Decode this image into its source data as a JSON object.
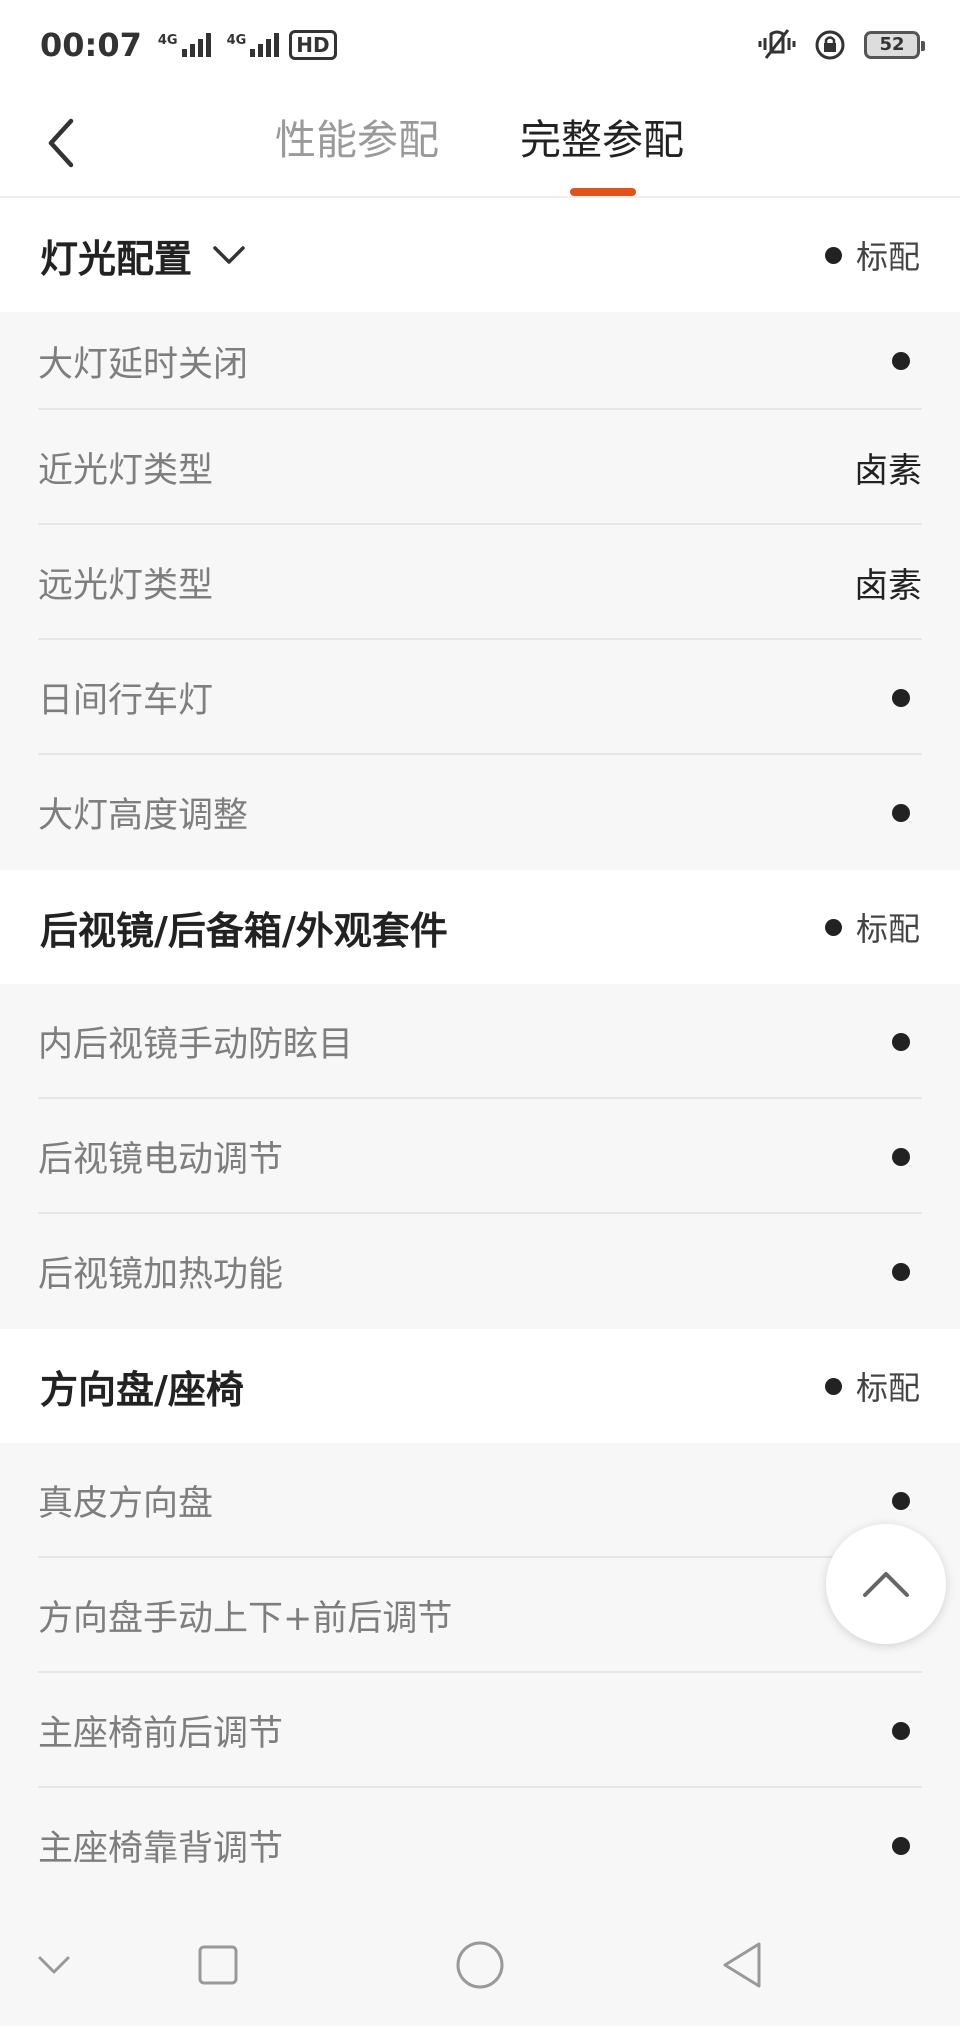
{
  "status_bar": {
    "time": "00:07",
    "network_1": "4G",
    "network_2": "4G",
    "hd": "HD",
    "battery": "52"
  },
  "header": {
    "tabs": [
      {
        "label": "性能参配",
        "active": false
      },
      {
        "label": "完整参配",
        "active": true
      }
    ],
    "accent_color": "#e0541c"
  },
  "sections": [
    {
      "title": "灯光配置",
      "legend_label": "标配",
      "rows": [
        {
          "label": "大灯延时关闭",
          "value": "",
          "standard": true
        },
        {
          "label": "近光灯类型",
          "value": "卤素",
          "standard": false
        },
        {
          "label": "远光灯类型",
          "value": "卤素",
          "standard": false
        },
        {
          "label": "日间行车灯",
          "value": "",
          "standard": true
        },
        {
          "label": "大灯高度调整",
          "value": "",
          "standard": true
        }
      ]
    },
    {
      "title": "后视镜/后备箱/外观套件",
      "legend_label": "标配",
      "rows": [
        {
          "label": "内后视镜手动防眩目",
          "value": "",
          "standard": true
        },
        {
          "label": "后视镜电动调节",
          "value": "",
          "standard": true
        },
        {
          "label": "后视镜加热功能",
          "value": "",
          "standard": true
        }
      ]
    },
    {
      "title": "方向盘/座椅",
      "legend_label": "标配",
      "rows": [
        {
          "label": "真皮方向盘",
          "value": "",
          "standard": true
        },
        {
          "label": "方向盘手动上下+前后调节",
          "value": "",
          "standard": true
        },
        {
          "label": "主座椅前后调节",
          "value": "",
          "standard": true
        },
        {
          "label": "主座椅靠背调节",
          "value": "",
          "standard": true
        }
      ]
    }
  ]
}
